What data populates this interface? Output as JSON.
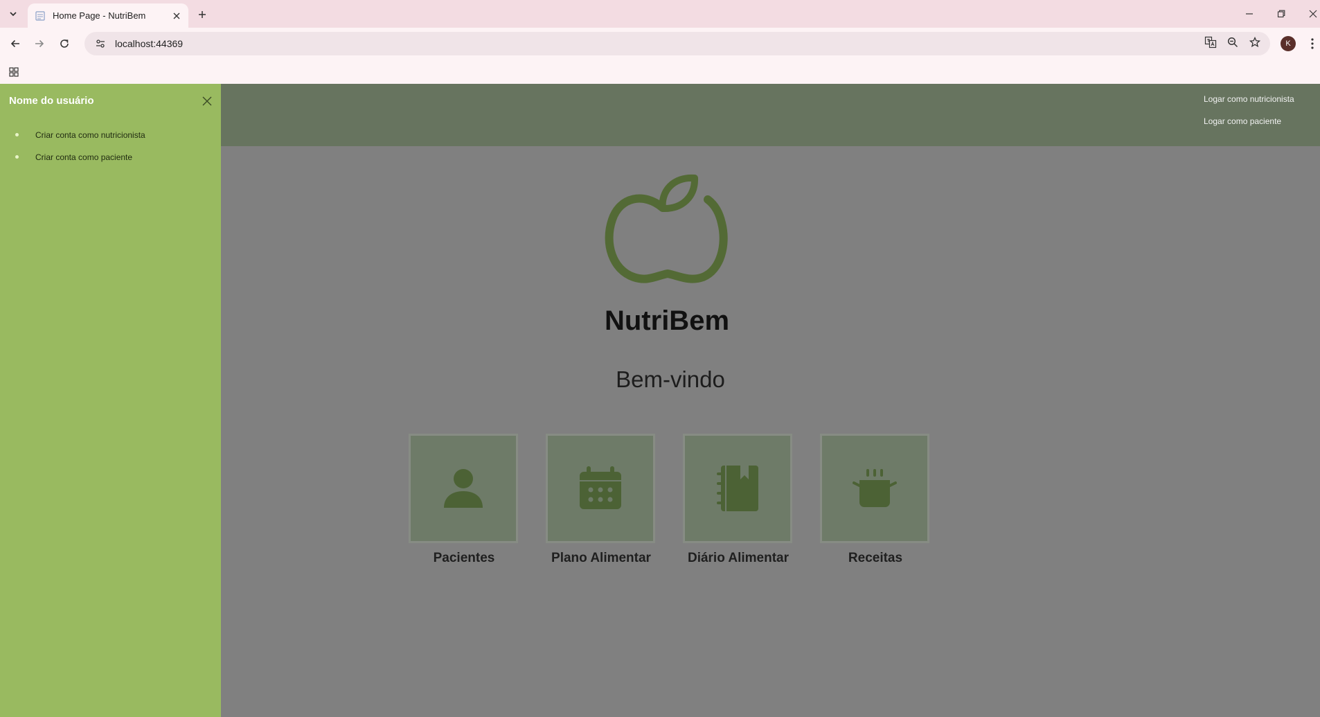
{
  "browser": {
    "tab_title": "Home Page - NutriBem",
    "url": "localhost:44369",
    "profile_initial": "K"
  },
  "sidebar": {
    "title": "Nome do usuário",
    "items": [
      {
        "label": "Criar conta como nutricionista"
      },
      {
        "label": "Criar conta como paciente"
      }
    ]
  },
  "topnav": {
    "links": [
      {
        "label": "Logar como nutricionista"
      },
      {
        "label": "Logar como paciente"
      }
    ]
  },
  "main": {
    "brand": "NutriBem",
    "welcome": "Bem-vindo",
    "cards": [
      {
        "label": "Pacientes",
        "icon": "user-icon"
      },
      {
        "label": "Plano Alimentar",
        "icon": "calendar-icon"
      },
      {
        "label": "Diário Alimentar",
        "icon": "food-diary-icon"
      },
      {
        "label": "Receitas",
        "icon": "cooking-pot-icon"
      }
    ]
  },
  "colors": {
    "sidebar_bg": "#99ba60",
    "topnav_bg": "#67745f",
    "overlay_bg": "#808080",
    "card_bg": "#6e7b68",
    "icon_green": "#4c6235",
    "tab_strip": "#f3dce2"
  }
}
